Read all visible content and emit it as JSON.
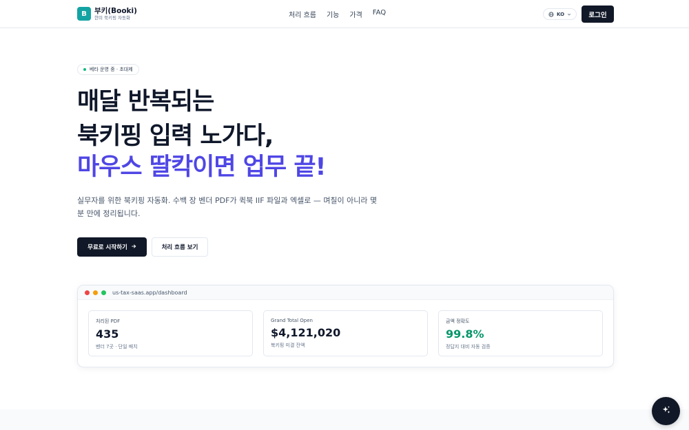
{
  "brand": {
    "logo_letter": "B",
    "name": "부키(Booki)",
    "tagline": "한미 북키핑 자동화",
    "color": "#14a3a3"
  },
  "nav": {
    "items": [
      "처리 흐름",
      "기능",
      "가격",
      "FAQ"
    ]
  },
  "header": {
    "language": "KO",
    "login_label": "로그인"
  },
  "hero": {
    "badge": "베타 운영 중 · 초대제",
    "title_line1": "매달 반복되는",
    "title_line2": "북키핑 입력 노가다,",
    "title_line3": "마우스 딸칵이면 업무 끝!",
    "accent_color": "#4f46e5",
    "description": "실무자를 위한 북키핑 자동화. 수백 장 벤더 PDF가 퀵북 IIF 파일과 엑셀로 — 며칠이 아니라 몇 분 만에 정리됩니다.",
    "cta_primary": "무료로 시작하기",
    "cta_secondary": "처리 흐름 보기"
  },
  "preview": {
    "url": "us-tax-saas.app/dashboard",
    "cards": [
      {
        "label": "처리된 PDF",
        "value": "435",
        "sub": "벤더 7곳 · 단일 배치"
      },
      {
        "label": "Grand Total Open",
        "value": "$4,121,020",
        "sub": "북키핑 미결 잔액"
      },
      {
        "label": "금액 정확도",
        "value": "99.8%",
        "sub": "정답지 대비 자동 검증"
      }
    ]
  }
}
